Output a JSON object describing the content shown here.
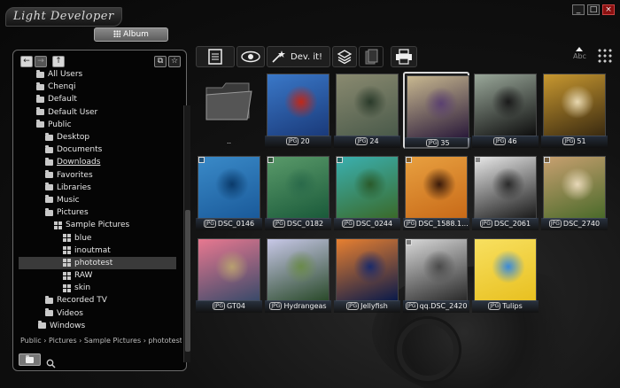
{
  "app": {
    "title": "Light Developer"
  },
  "window": {
    "minimize": "_",
    "maximize": "□",
    "close": "×"
  },
  "tabs": {
    "album": "Album"
  },
  "toolbar": {
    "develop_label": "Dev. it!"
  },
  "sort": {
    "label": "Abc"
  },
  "tree": {
    "items": [
      {
        "label": "All Users",
        "level": 1,
        "icon": "folder-icon"
      },
      {
        "label": "Chenqi",
        "level": 1,
        "icon": "folder-icon"
      },
      {
        "label": "Default",
        "level": 1,
        "icon": "folder-icon"
      },
      {
        "label": "Default User",
        "level": 1,
        "icon": "folder-icon"
      },
      {
        "label": "Public",
        "level": 1,
        "icon": "folder-icon"
      },
      {
        "label": "Desktop",
        "level": 2,
        "icon": "folder-icon"
      },
      {
        "label": "Documents",
        "level": 2,
        "icon": "folder-icon"
      },
      {
        "label": "Downloads",
        "level": 2,
        "icon": "folder-icon",
        "underline": true
      },
      {
        "label": "Favorites",
        "level": 2,
        "icon": "folder-icon"
      },
      {
        "label": "Libraries",
        "level": 2,
        "icon": "folder-icon"
      },
      {
        "label": "Music",
        "level": 2,
        "icon": "folder-icon"
      },
      {
        "label": "Pictures",
        "level": 2,
        "icon": "folder-icon"
      },
      {
        "label": "Sample Pictures",
        "level": 3,
        "icon": "grid-icon"
      },
      {
        "label": "blue",
        "level": 4,
        "icon": "grid-icon"
      },
      {
        "label": "inoutmat",
        "level": 4,
        "icon": "grid-icon"
      },
      {
        "label": "phototest",
        "level": 4,
        "icon": "grid-icon",
        "selected": true
      },
      {
        "label": "RAW",
        "level": 4,
        "icon": "grid-icon"
      },
      {
        "label": "skin",
        "level": 4,
        "icon": "grid-icon"
      },
      {
        "label": "Recorded TV",
        "level": 2,
        "icon": "folder-icon"
      },
      {
        "label": "Videos",
        "level": 2,
        "icon": "folder-icon"
      },
      {
        "label": "Windows",
        "level": 1,
        "icon": "folder-icon",
        "indentOverride": 0
      }
    ]
  },
  "breadcrumb": "Public › Pictures › Sample Pictures › phototest",
  "thumbnails": [
    {
      "label": "..",
      "kind": "folder",
      "col": 0,
      "row": 0
    },
    {
      "label": "20",
      "col": 1,
      "row": 0,
      "colors": [
        "#1a3a7a",
        "#3a78c8",
        "#c02818"
      ]
    },
    {
      "label": "24",
      "col": 2,
      "row": 0,
      "colors": [
        "#4a5a4a",
        "#8a8a70",
        "#2a3a2a"
      ]
    },
    {
      "label": "35",
      "col": 3,
      "row": 0,
      "selected": true,
      "colors": [
        "#2a1a3a",
        "#c8b890",
        "#5a4070"
      ]
    },
    {
      "label": "46",
      "col": 4,
      "row": 0,
      "colors": [
        "#0e0e0e",
        "#9aa89a",
        "#1a1a1a"
      ]
    },
    {
      "label": "51",
      "col": 5,
      "row": 0,
      "colors": [
        "#3a2a10",
        "#c89830",
        "#e8d8b0"
      ]
    },
    {
      "label": "DSC_0146",
      "col": 0,
      "row": 1,
      "colors": [
        "#1a5a9a",
        "#3a8ac8",
        "#0a3a6a"
      ],
      "corner": true
    },
    {
      "label": "DSC_0182",
      "col": 1,
      "row": 1,
      "colors": [
        "#1a5a3a",
        "#5a9a6a",
        "#2a6a4a"
      ],
      "corner": true
    },
    {
      "label": "DSC_0244",
      "col": 2,
      "row": 1,
      "colors": [
        "#3a6a2a",
        "#3ab0b0",
        "#2a5a2a"
      ],
      "corner": true
    },
    {
      "label": "DSC_1588.1...",
      "col": 3,
      "row": 1,
      "colors": [
        "#c86a18",
        "#e8a040",
        "#3a1a0a"
      ],
      "corner": true
    },
    {
      "label": "DSC_2061",
      "col": 4,
      "row": 1,
      "colors": [
        "#1a1a1a",
        "#e8e8e8",
        "#2a2a2a"
      ],
      "corner": true
    },
    {
      "label": "DSC_2740",
      "col": 5,
      "row": 1,
      "colors": [
        "#4a6a2a",
        "#c8a070",
        "#e8d8b8"
      ],
      "corner": true
    },
    {
      "label": "GT04",
      "col": 0,
      "row": 2,
      "colors": [
        "#3a4a6a",
        "#e87890",
        "#b8a070"
      ]
    },
    {
      "label": "Hydrangeas",
      "col": 1,
      "row": 2,
      "colors": [
        "#2a4a2a",
        "#c8c8e8",
        "#6a8a4a"
      ]
    },
    {
      "label": "Jellyfish",
      "col": 2,
      "row": 2,
      "colors": [
        "#0a1a4a",
        "#e88030",
        "#1a2a6a"
      ]
    },
    {
      "label": "qq.DSC_2420",
      "col": 3,
      "row": 2,
      "colors": [
        "#2a2a2a",
        "#d8d8d8",
        "#4a4a4a"
      ],
      "corner": true
    },
    {
      "label": "Tulips",
      "col": 4,
      "row": 2,
      "colors": [
        "#e8c020",
        "#f8e060",
        "#3a8ad8"
      ]
    }
  ]
}
